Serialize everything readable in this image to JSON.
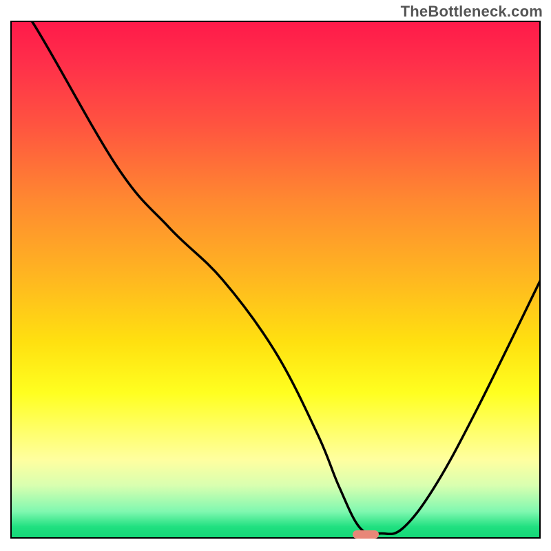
{
  "attribution": "TheBottleneck.com",
  "chart_data": {
    "type": "line",
    "title": "",
    "xlabel": "",
    "ylabel": "",
    "xlim": [
      0,
      100
    ],
    "ylim": [
      0,
      100
    ],
    "x": [
      0,
      4,
      20,
      30,
      40,
      50,
      58,
      62,
      66,
      70,
      74,
      80,
      88,
      100
    ],
    "values": [
      103,
      100,
      72,
      60,
      50,
      36,
      20,
      10,
      2,
      1,
      2,
      10,
      25,
      50
    ],
    "series_name": "bottleneck",
    "marker": {
      "x": 67,
      "y": 0.8,
      "width_pct": 5,
      "height_pct": 1.6
    },
    "gradient_stops": [
      {
        "pos": 0,
        "color": "#ff1a4a"
      },
      {
        "pos": 8,
        "color": "#ff2f4a"
      },
      {
        "pos": 20,
        "color": "#ff5440"
      },
      {
        "pos": 35,
        "color": "#ff8a30"
      },
      {
        "pos": 50,
        "color": "#ffb820"
      },
      {
        "pos": 62,
        "color": "#ffe010"
      },
      {
        "pos": 72,
        "color": "#ffff20"
      },
      {
        "pos": 80,
        "color": "#ffff70"
      },
      {
        "pos": 85,
        "color": "#ffffa0"
      },
      {
        "pos": 90,
        "color": "#d8ffb0"
      },
      {
        "pos": 95,
        "color": "#80f8b0"
      },
      {
        "pos": 98,
        "color": "#20e080"
      },
      {
        "pos": 100,
        "color": "#15d878"
      }
    ]
  },
  "colors": {
    "attribution_text": "#555555",
    "curve_stroke": "#000000",
    "marker_fill": "#e88778",
    "border": "#000000"
  }
}
